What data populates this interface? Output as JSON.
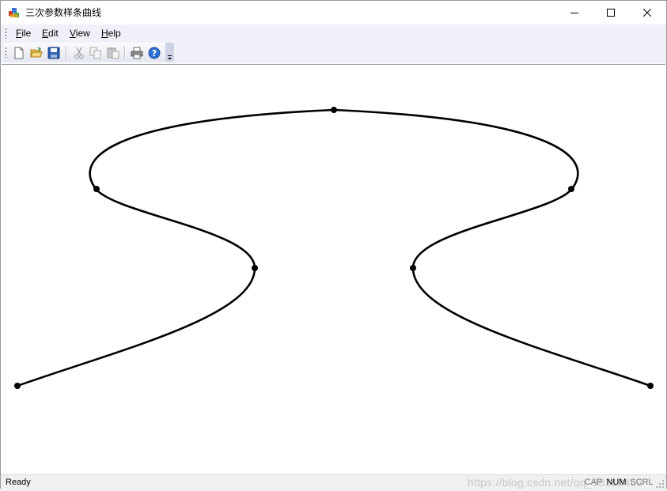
{
  "window": {
    "title": "三次参数样条曲线"
  },
  "menu": {
    "items": [
      "File",
      "Edit",
      "View",
      "Help"
    ]
  },
  "toolbar": {
    "buttons": [
      "new-icon",
      "open-icon",
      "save-icon",
      "cut-icon",
      "copy-icon",
      "paste-icon",
      "print-icon",
      "help-icon"
    ]
  },
  "canvas": {
    "background": "#ffffff",
    "curve_color": "#000000"
  },
  "statusbar": {
    "text": "Ready",
    "indicators": [
      "CAP",
      "NUM",
      "SCRL"
    ],
    "watermark": "https://blog.csdn.net/qq_38312463"
  }
}
